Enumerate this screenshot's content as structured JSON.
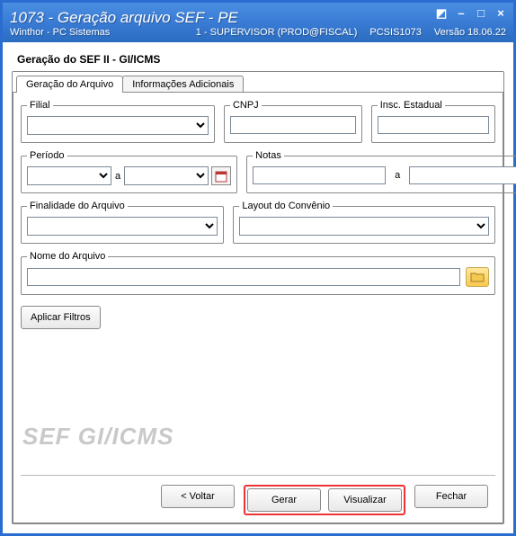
{
  "titlebar": {
    "main": "1073 - Geração arquivo SEF - PE",
    "sub_left": "Winthor - PC Sistemas",
    "sub_mid": "1 - SUPERVISOR (PROD@FISCAL)",
    "sub_code": "PCSIS1073",
    "sub_version": "Versão 18.06.22"
  },
  "group_title": "Geração do SEF II - GI/ICMS",
  "tabs": {
    "t1": "Geração do Arquivo",
    "t2": "Informações Adicionais"
  },
  "fields": {
    "filial": "Filial",
    "cnpj": "CNPJ",
    "insc": "Insc. Estadual",
    "periodo": "Período",
    "notas": "Notas",
    "finalidade": "Finalidade do Arquivo",
    "layout": "Layout do Convênio",
    "nome_arq": "Nome do Arquivo",
    "sep_a": "a",
    "notas_a": "a"
  },
  "values": {
    "filial": "",
    "cnpj": "",
    "insc": "",
    "periodo_de": "",
    "periodo_ate": "",
    "notas_de": "",
    "notas_ate": "",
    "finalidade": "",
    "layout": "",
    "nome_arq": ""
  },
  "buttons": {
    "aplicar": "Aplicar Filtros",
    "voltar": "< Voltar",
    "gerar": "Gerar",
    "visualizar": "Visualizar",
    "fechar": "Fechar"
  },
  "watermark": "SEF GI/ICMS",
  "icons": {
    "folder": "folder-icon",
    "calendar": "calendar-icon"
  }
}
